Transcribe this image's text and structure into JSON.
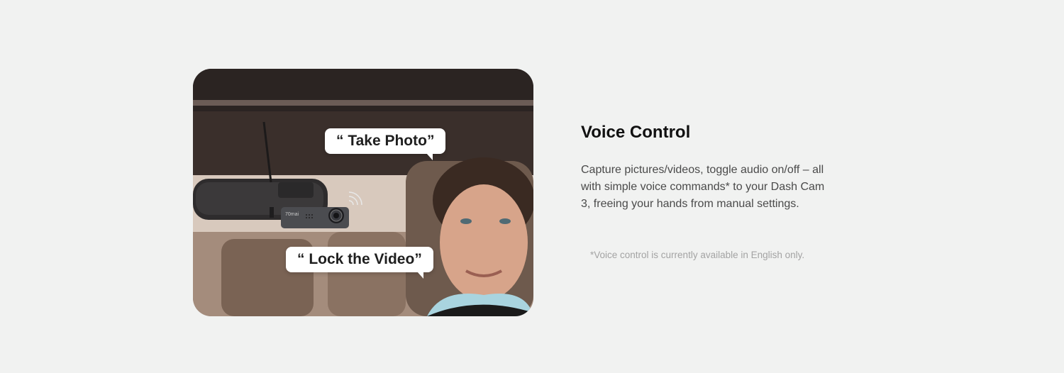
{
  "feature": {
    "title": "Voice Control",
    "description": "Capture pictures/videos, toggle audio on/off – all with simple voice commands* to your Dash Cam 3, freeing your hands from manual settings.",
    "note": "*Voice control is currently available in English only."
  },
  "image": {
    "bubbles": [
      {
        "text": "“ Take Photo”"
      },
      {
        "text": "“ Lock the Video”"
      }
    ],
    "device_brand": "70mai"
  }
}
